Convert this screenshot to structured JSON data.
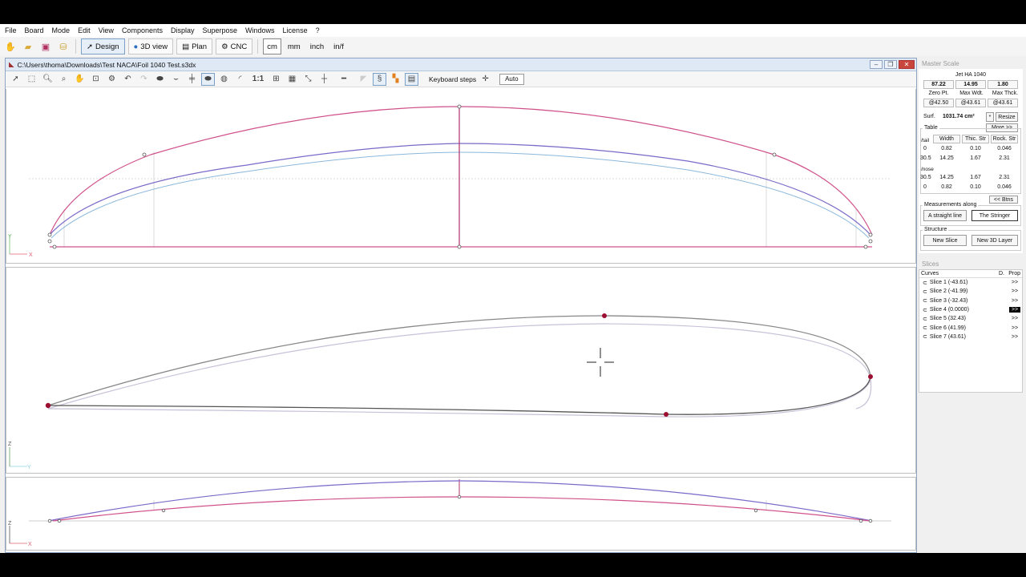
{
  "menu": [
    "File",
    "Board",
    "Mode",
    "Edit",
    "View",
    "Components",
    "Display",
    "Superpose",
    "Windows",
    "License",
    "?"
  ],
  "modes": {
    "design": "Design",
    "view3d": "3D view",
    "plan": "Plan",
    "cnc": "CNC"
  },
  "units": [
    "cm",
    "mm",
    "inch",
    "in/f"
  ],
  "document": {
    "title": "C:\\Users\\thoma\\Downloads\\Test NACA\\Foil 1040 Test.s3dx",
    "scale_label": "1:1",
    "keyboard_steps": "Keyboard steps",
    "auto": "Auto"
  },
  "axes": {
    "x": "X",
    "y": "Y",
    "z": "Z"
  },
  "master_scale": {
    "title": "Master Scale",
    "board_name": "Jet HA 1040",
    "length": "87.22",
    "width": "14.95",
    "thickness": "1.80",
    "zero_label": "Zero Pt.",
    "maxw_label": "Max Wdt.",
    "maxt_label": "Max Thck.",
    "zero_val": "@42.50",
    "maxw_val": "@43.61",
    "maxt_val": "@43.61",
    "surf_label": "Surf.",
    "surf_val": "1031.74 cm²",
    "star": "*",
    "resize": "Resize",
    "more": "More >>",
    "table_label": "Table",
    "col_width": "Width",
    "col_thic": "Thic. Str",
    "col_rock": "Rock. Str",
    "tail_label": "/tail",
    "nose_label": "/nose",
    "rows": [
      {
        "pos": "0",
        "w": "0.82",
        "t": "0.10",
        "r": "0.046"
      },
      {
        "pos": "30.5",
        "w": "14.25",
        "t": "1.67",
        "r": "2.31"
      },
      {
        "pos": "30.5",
        "w": "14.25",
        "t": "1.67",
        "r": "2.31"
      },
      {
        "pos": "0",
        "w": "0.82",
        "t": "0.10",
        "r": "0.046"
      }
    ],
    "btns": "<< Btns",
    "measure_label": "Measurements along",
    "straight": "A straight line",
    "stringer": "The Stringer",
    "structure_label": "Structure",
    "new_slice": "New Slice",
    "new_layer": "New 3D Layer"
  },
  "slices": {
    "title": "Slices",
    "col_curves": "Curves",
    "col_d": "D.",
    "col_prop": "Prop",
    "items": [
      "Slice 1 (-43.61)",
      "Slice 2 (-41.99)",
      "Slice 3 (-32.43)",
      "Slice 4 (0.0000)",
      "Slice 5 (32.43)",
      "Slice 6 (41.99)",
      "Slice 7 (43.61)"
    ],
    "arrow": ">>",
    "selected_index": 3
  },
  "colors": {
    "outline": "#d0508a",
    "blue": "#7b68c8",
    "lightblue": "#8ab8dc",
    "foil_dark": "#888888",
    "foil_light": "#c8c0d8",
    "point": "#9b1030"
  }
}
